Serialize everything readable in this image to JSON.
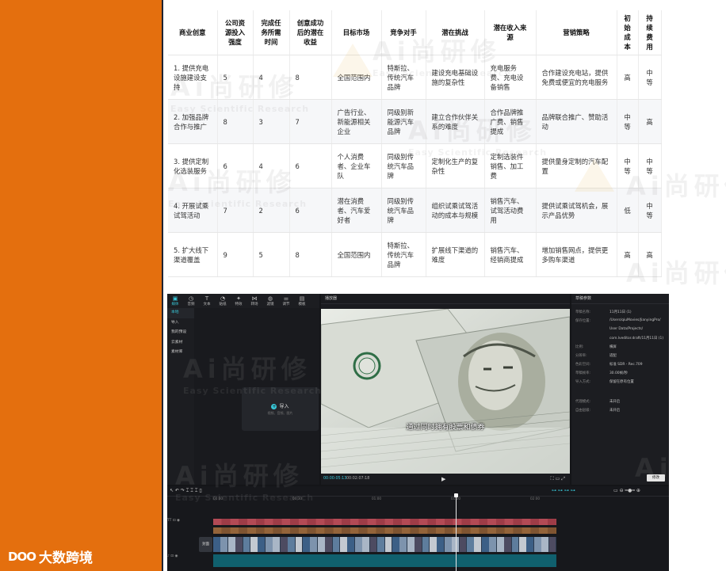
{
  "table": {
    "headers": [
      "商业创意",
      "公司资源投入强度",
      "完成任务所需时间",
      "创意成功后的潜在收益",
      "目标市场",
      "竞争对手",
      "潜在挑战",
      "潜在收入来源",
      "营销策略",
      "初始成本",
      "持续费用"
    ],
    "rows": [
      [
        "1. 提供充电设施建设支持",
        "5",
        "4",
        "8",
        "全国范围内",
        "特斯拉、传统汽车品牌",
        "建设充电基础设施的复杂性",
        "充电服务费、充电设备销售",
        "合作建设充电站，提供免费或便宜的充电服务",
        "高",
        "中等"
      ],
      [
        "2. 加强品牌合作与推广",
        "8",
        "3",
        "7",
        "广告行业、新能源相关企业",
        "同级别新能源汽车品牌",
        "建立合作伙伴关系的难度",
        "合作品牌推广费、销售提成",
        "品牌联合推广、赞助活动",
        "中等",
        "高"
      ],
      [
        "3. 提供定制化选装服务",
        "6",
        "4",
        "6",
        "个人消费者、企业车队",
        "同级别传统汽车品牌",
        "定制化生产的复杂性",
        "定制选装件销售、加工费",
        "提供量身定制的汽车配置",
        "中等",
        "中等"
      ],
      [
        "4. 开展试乘试驾活动",
        "7",
        "2",
        "6",
        "潜在消费者、汽车爱好者",
        "同级别传统汽车品牌",
        "组织试乘试驾活动的成本与规模",
        "销售汽车、试驾活动费用",
        "提供试乘试驾机会，展示产品优势",
        "低",
        "中等"
      ],
      [
        "5. 扩大线下渠道覆盖",
        "9",
        "5",
        "8",
        "全国范围内",
        "特斯拉、传统汽车品牌",
        "扩展线下渠道的难度",
        "销售汽车、经销商提成",
        "增加销售网点，提供更多购车渠道",
        "高",
        "高"
      ]
    ]
  },
  "watermark": {
    "cn": "Ai尚研修",
    "en": "Easy Scientific Research"
  },
  "logo": {
    "mark": "DOO",
    "name": "大数跨境"
  },
  "editor": {
    "tabs": [
      "媒体",
      "音频",
      "文本",
      "贴纸",
      "特效",
      "转场",
      "滤镜",
      "调节",
      "模板"
    ],
    "side_items": [
      "本地",
      "导入",
      "我的预设",
      "云素材",
      "素材库"
    ],
    "import_label": "导入",
    "import_sub": "视频、音频、图片",
    "player_title": "播放器",
    "subtitle": "通过同时拥有股票和债券",
    "time_current": "00:00:05:13",
    "time_total": "00:02:07:18",
    "props_title": "草稿参数",
    "props": [
      {
        "k": "草稿名称:",
        "v": "11月11日 (1)"
      },
      {
        "k": "保存位置:",
        "v": "/Users/qiuMovies/JianyingPro/"
      },
      {
        "k": "",
        "v": "User Data/Projects/"
      },
      {
        "k": "",
        "v": "com.lveditor.draft/11月11日 (1)"
      },
      {
        "k": "比例:",
        "v": "横屏"
      },
      {
        "k": "分辨率:",
        "v": "适配"
      },
      {
        "k": "色彩空间:",
        "v": "标准 SDR - Rec.709"
      },
      {
        "k": "草稿帧率:",
        "v": "30.00帧/秒"
      },
      {
        "k": "导入方式:",
        "v": "保留在原有位置"
      },
      {
        "k": "代理模式:",
        "v": "未开启"
      },
      {
        "k": "自由层级:",
        "v": "未开启"
      }
    ],
    "export_label": "修改",
    "cover_label": "封面",
    "ruler": [
      "00:00",
      "00:30",
      "01:00",
      "01:30",
      "02:00"
    ]
  }
}
